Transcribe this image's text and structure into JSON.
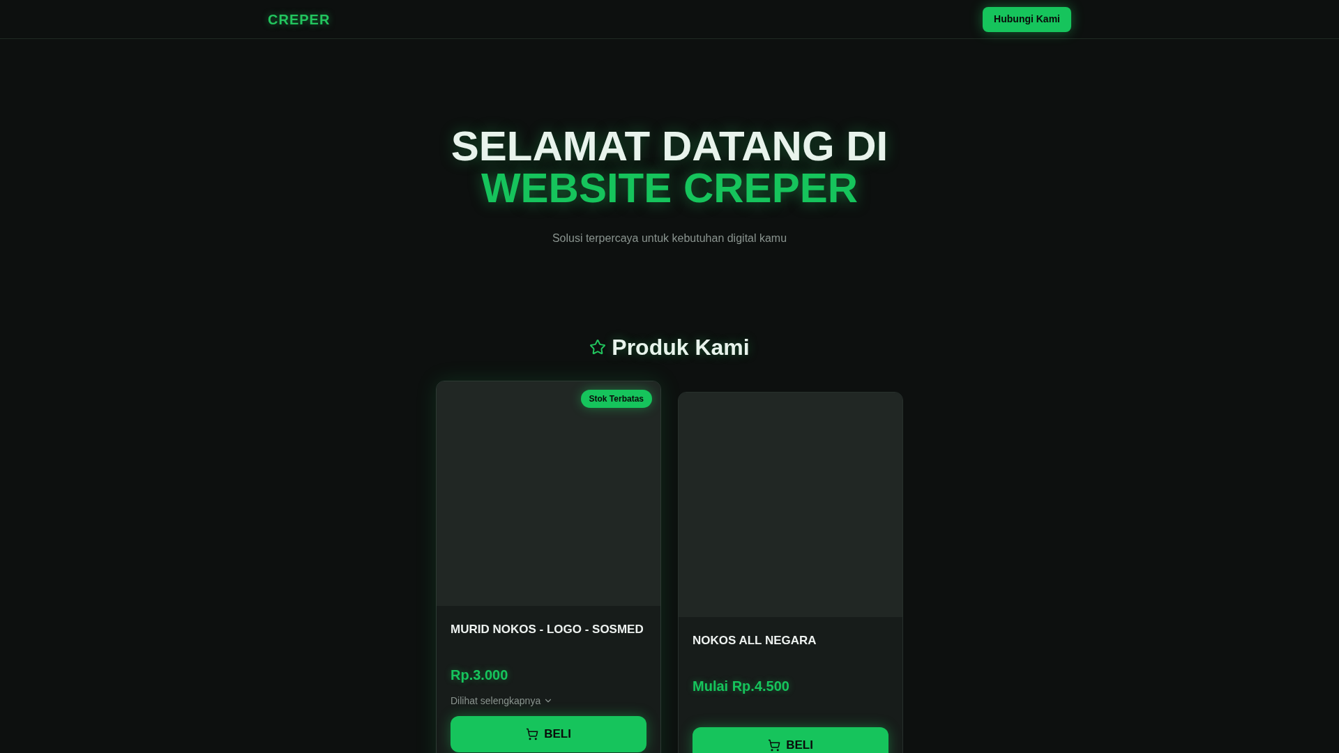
{
  "nav": {
    "logo": "CREPER",
    "contact_button": "Hubungi Kami"
  },
  "hero": {
    "title_line1": "SELAMAT DATANG DI",
    "title_line2": "WEBSITE CREPER",
    "subtitle": "Solusi terpercaya untuk kebutuhan digital kamu"
  },
  "products": {
    "heading": "Produk Kami",
    "items": [
      {
        "badge": "Stok Terbatas",
        "name": "MURID NOKOS - LOGO - SOSMED",
        "price": "Rp.3.000",
        "more_link": "Dilihat selengkapnya",
        "buy_button": "BELI",
        "highlighted": true
      },
      {
        "name": "NOKOS ALL NEGARA",
        "price": "Mulai Rp.4.500",
        "buy_button": "BELI",
        "highlighted": false
      }
    ]
  }
}
